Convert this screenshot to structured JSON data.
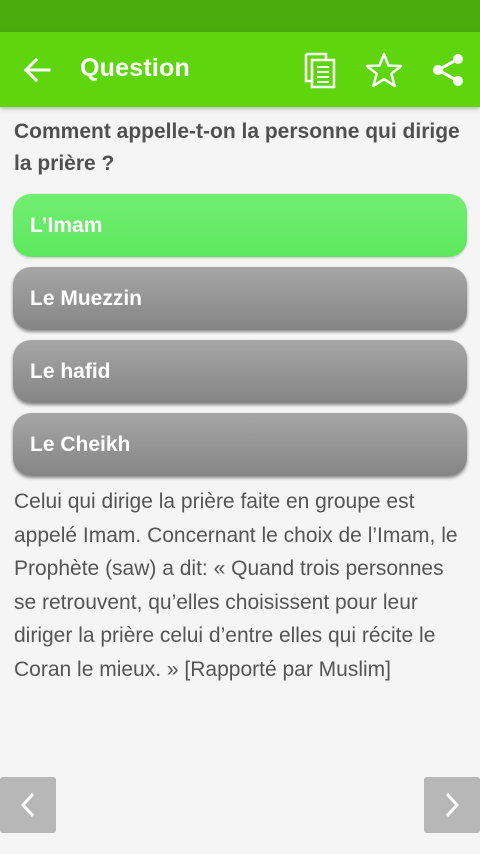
{
  "app_bar": {
    "title": "Question",
    "back_icon": "arrow-left-icon",
    "actions": [
      "copy-icon",
      "star-icon",
      "share-icon"
    ]
  },
  "question": "Comment appelle-t-on la personne qui dirige la prière ?",
  "answers": [
    {
      "label": "L’Imam",
      "state": "correct"
    },
    {
      "label": "Le Muezzin",
      "state": "default"
    },
    {
      "label": "Le hafid",
      "state": "default"
    },
    {
      "label": "Le Cheikh",
      "state": "default"
    }
  ],
  "explanation": "Celui qui dirige la prière faite en groupe est appelé Imam. Concernant le choix de l’Imam, le Prophète (saw) a dit: « Quand trois personnes se retrouvent, qu’elles choisissent pour leur diriger la prière celui d’entre elles qui récite le Coran le mieux. » [Rapporté par Muslim]",
  "navigation": {
    "prev_icon": "chevron-left-icon",
    "next_icon": "chevron-right-icon"
  },
  "colors": {
    "status_bar": "#4aad0c",
    "app_bar": "#5fd50e",
    "correct_answer": "#6aec6a",
    "default_answer": "#959595",
    "nav_button": "#b7b7b7"
  }
}
